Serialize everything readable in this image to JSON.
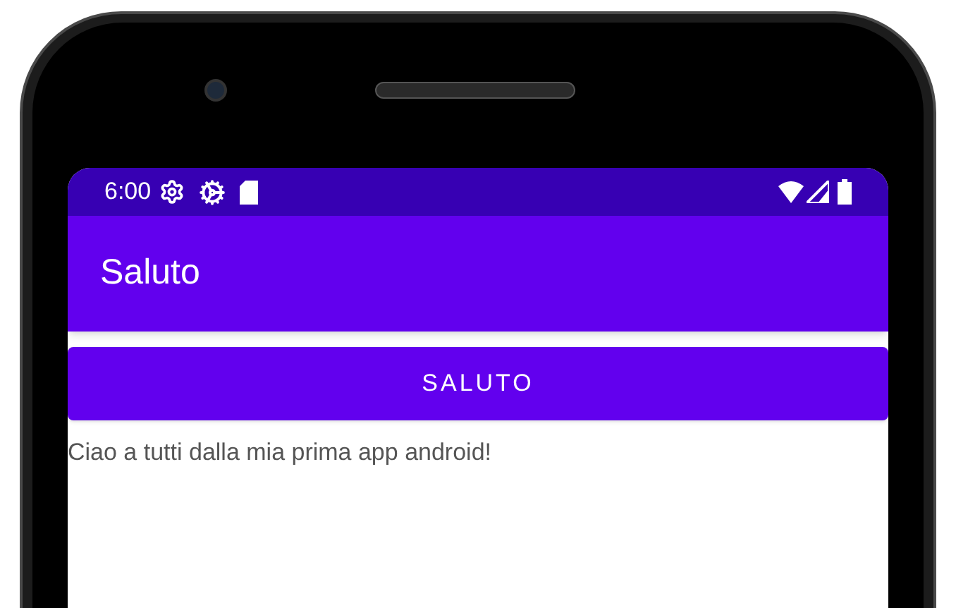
{
  "status_bar": {
    "time": "6:00"
  },
  "app_bar": {
    "title": "Saluto"
  },
  "button": {
    "label": "SALUTO"
  },
  "message": "Ciao a tutti dalla mia prima app android!"
}
